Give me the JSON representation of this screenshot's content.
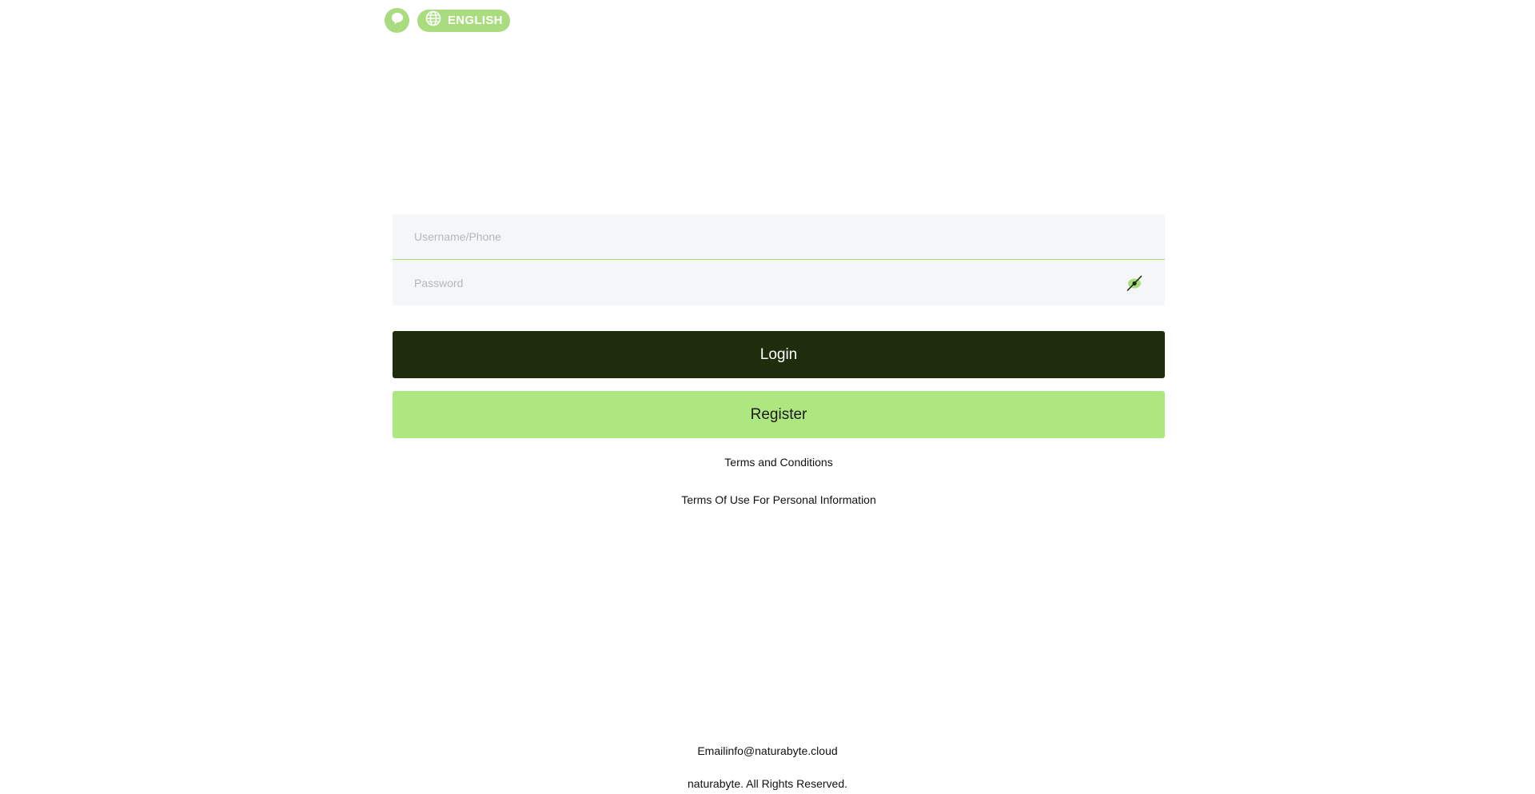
{
  "header": {
    "support_icon": "chat-bubble-icon",
    "language_icon": "globe-icon",
    "language_label": "ENGLISH"
  },
  "login_form": {
    "username_placeholder": "Username/Phone",
    "password_placeholder": "Password",
    "username_value": "",
    "password_value": "",
    "password_toggle_icon": "eye-slash-icon",
    "login_label": "Login",
    "register_label": "Register"
  },
  "links": {
    "terms": "Terms and Conditions",
    "privacy": "Terms Of Use For Personal Information"
  },
  "footer": {
    "email": "Emailinfo@naturabyte.cloud",
    "copyright": "naturabyte. All Rights Reserved."
  },
  "colors": {
    "accent_green": "#a9db7f",
    "register_green": "#aee680",
    "login_dark": "#1e2d0b",
    "field_bg": "#f5f6f7"
  }
}
